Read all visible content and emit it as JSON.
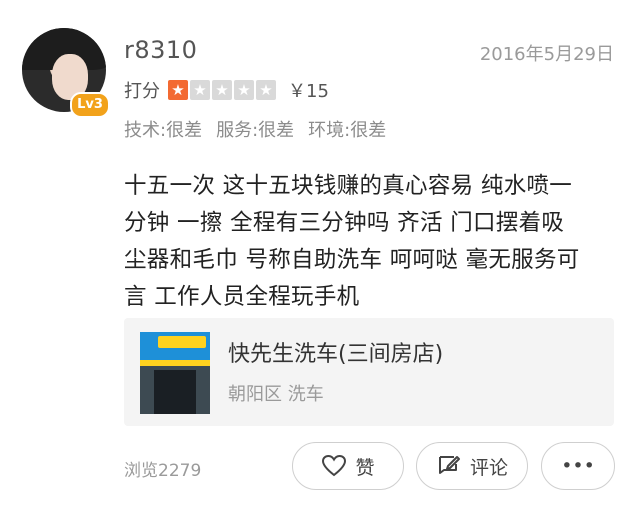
{
  "user": {
    "name": "r8310",
    "level_badge": "Lv3",
    "avatar_icon": "user-avatar"
  },
  "review": {
    "date": "2016年5月29日",
    "rating_label": "打分",
    "stars_total": 5,
    "stars_filled": 1,
    "price": "￥15",
    "sub_scores": [
      "技术:很差",
      "服务:很差",
      "环境:很差"
    ],
    "text_lines": [
      "十五一次 这十五块钱赚的真心容易 纯水喷一",
      "分钟 一擦 全程有三分钟吗 齐活 门口摆着吸",
      "尘器和毛巾 号称自助洗车 呵呵哒 毫无服务可",
      "言 工作人员全程玩手机"
    ]
  },
  "shop": {
    "name": "快先生洗车(三间房店)",
    "meta": "朝阳区 洗车"
  },
  "footer": {
    "views": "浏览2279",
    "like_label": "赞",
    "comment_label": "评论",
    "more_label": "•••"
  },
  "colors": {
    "accent_star": "#f36a32",
    "star_off": "#d9d9d9",
    "level_badge": "#f2a21b"
  }
}
